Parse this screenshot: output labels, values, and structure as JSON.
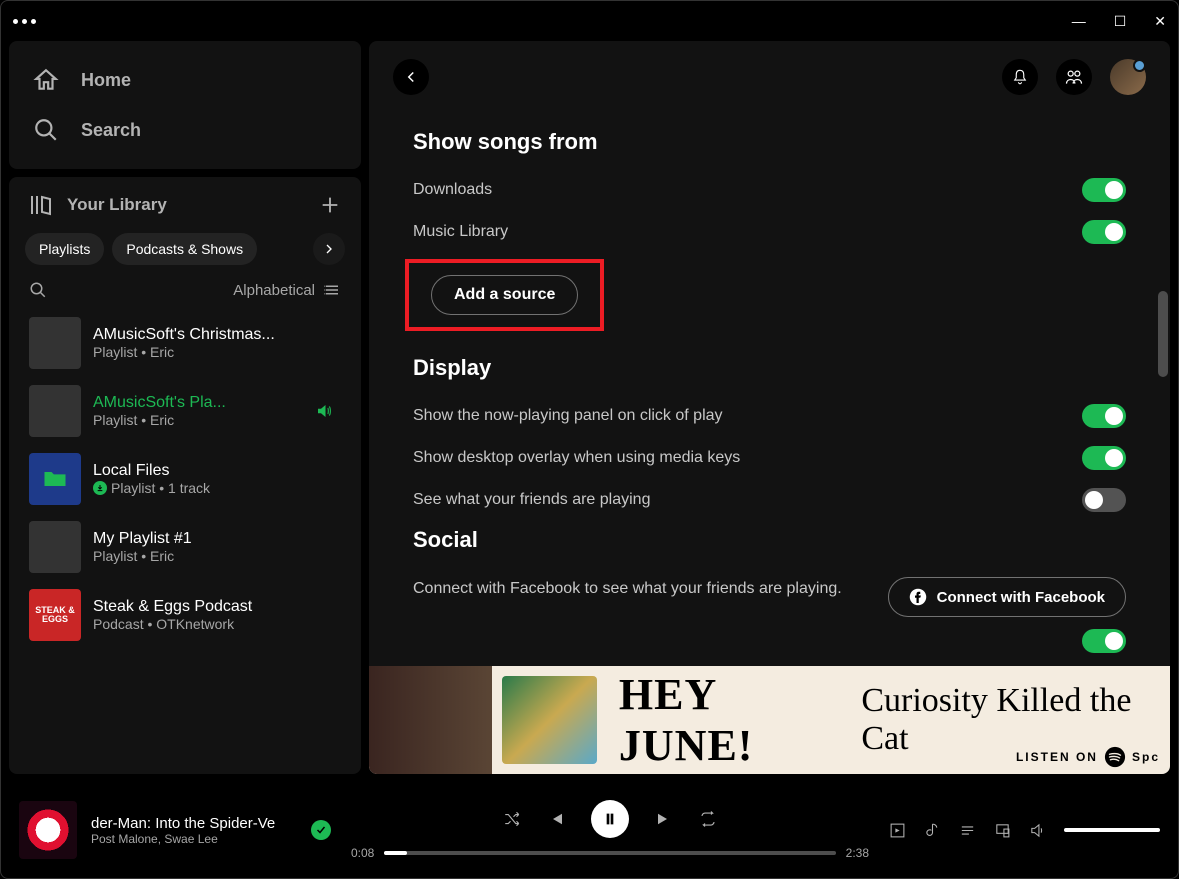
{
  "titlebar": {
    "minimize": "—",
    "maximize": "☐",
    "close": "✕"
  },
  "nav": {
    "home": "Home",
    "search": "Search"
  },
  "library": {
    "title": "Your Library",
    "chips": [
      "Playlists",
      "Podcasts & Shows"
    ],
    "sort": "Alphabetical",
    "items": [
      {
        "name": "AMusicSoft's Christmas...",
        "meta": "Playlist • Eric",
        "cover": "grid"
      },
      {
        "name": "AMusicSoft's Pla...",
        "meta": "Playlist • Eric",
        "cover": "grid",
        "playing": true
      },
      {
        "name": "Local Files",
        "meta": "Playlist • 1 track",
        "cover": "folder",
        "downloaded": true
      },
      {
        "name": "My Playlist #1",
        "meta": "Playlist • Eric",
        "cover": "grid"
      },
      {
        "name": "Steak & Eggs Podcast",
        "meta": "Podcast • OTKnetwork",
        "cover": "red",
        "coverText": "STEAK & EGGS"
      }
    ]
  },
  "settings": {
    "section1_title": "Show songs from",
    "downloads": "Downloads",
    "music_library": "Music Library",
    "add_source": "Add a source",
    "section2_title": "Display",
    "display_row1": "Show the now-playing panel on click of play",
    "display_row2": "Show desktop overlay when using media keys",
    "display_row3": "See what your friends are playing",
    "section3_title": "Social",
    "social_text": "Connect with Facebook to see what your friends are playing.",
    "fb_button": "Connect with Facebook"
  },
  "banner": {
    "t1": "HEY JUNE!",
    "t2": "Curiosity Killed the Cat",
    "listen": "LISTEN ON",
    "brand": "Spc"
  },
  "player": {
    "title": "der-Man: Into the Spider-Ve",
    "artist": "Post Malone, Swae Lee",
    "elapsed": "0:08",
    "total": "2:38"
  }
}
